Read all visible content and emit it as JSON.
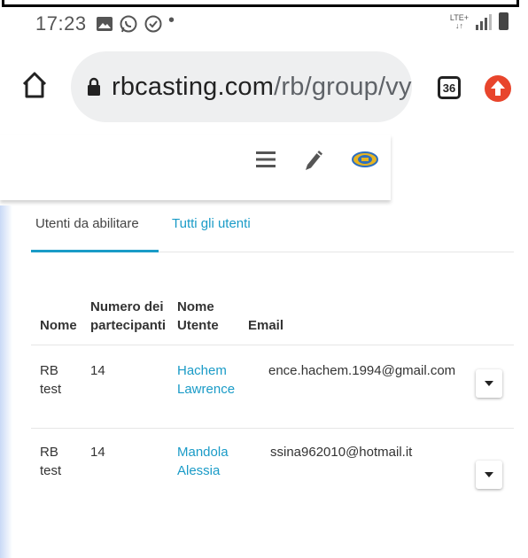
{
  "status_bar": {
    "time": "17:23",
    "dot": "•",
    "network": "LTE+",
    "icons": [
      "image-icon",
      "whatsapp-icon",
      "check-circle-icon",
      "signal-icon",
      "battery-icon"
    ]
  },
  "browser": {
    "url_host": "rbcasting.com",
    "url_path": "/rb/group/vy",
    "tab_count": "36"
  },
  "tabs": [
    {
      "label": "Utenti da abilitare",
      "active": true
    },
    {
      "label": "Tutti gli utenti",
      "active": false
    }
  ],
  "table": {
    "headers": {
      "nome": "Nome",
      "partecipanti_1": "Numero dei",
      "partecipanti_2": "partecipanti",
      "utente_1": "Nome",
      "utente_2": "Utente",
      "email": "Email"
    },
    "rows": [
      {
        "nome_1": "RB",
        "nome_2": "test",
        "partecipanti": "14",
        "utente_1": "Hachem",
        "utente_2": "Lawrence",
        "email": "ence.hachem.1994@gmail.com"
      },
      {
        "nome_1": "RB",
        "nome_2": "test",
        "partecipanti": "14",
        "utente_1": "Mandola",
        "utente_2": "Alessia",
        "email": "ssina962010@hotmail.it"
      }
    ]
  },
  "colors": {
    "accent": "#1a9bc7",
    "update_badge": "#e8452c"
  }
}
